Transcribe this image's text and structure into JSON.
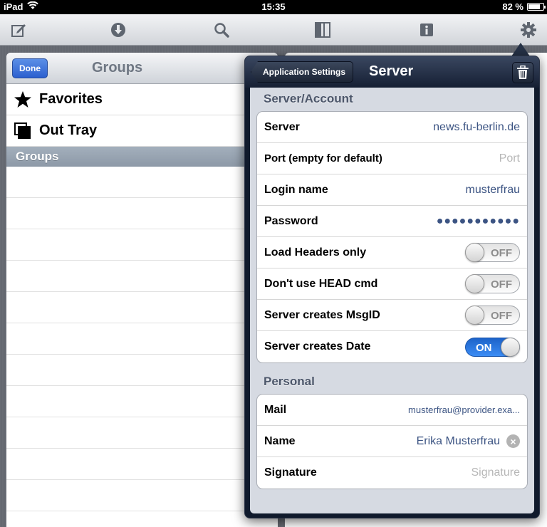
{
  "status_bar": {
    "device": "iPad",
    "time": "15:35",
    "battery": "82 %",
    "battery_level": 0.82
  },
  "toolbar": {
    "icons": [
      "compose-icon",
      "download-icon",
      "search-icon",
      "split-view-icon",
      "info-icon",
      "gear-icon"
    ]
  },
  "groups_panel": {
    "done_label": "Done",
    "title": "Groups",
    "items": [
      {
        "label": "Favorites",
        "icon": "star-icon"
      },
      {
        "label": "Out Tray",
        "icon": "out-tray-icon"
      }
    ],
    "section_header": "Groups"
  },
  "popover": {
    "back_label": "Application Settings",
    "title": "Server",
    "server_account_header": "Server/Account",
    "server_account_rows": {
      "server": {
        "label": "Server",
        "value": "news.fu-berlin.de"
      },
      "port": {
        "label": "Port (empty for default)",
        "placeholder": "Port"
      },
      "login": {
        "label": "Login name",
        "value": "musterfrau"
      },
      "password": {
        "label": "Password",
        "value": "●●●●●●●●●●●"
      },
      "load_headers": {
        "label": "Load Headers only",
        "state": "OFF"
      },
      "no_head": {
        "label": "Don't use HEAD cmd",
        "state": "OFF"
      },
      "msgid": {
        "label": "Server creates MsgID",
        "state": "OFF"
      },
      "date": {
        "label": "Server creates Date",
        "state": "ON"
      }
    },
    "personal_header": "Personal",
    "personal_rows": {
      "mail": {
        "label": "Mail",
        "value": "musterfrau@provider.exa..."
      },
      "name": {
        "label": "Name",
        "value": "Erika Musterfrau"
      },
      "signature": {
        "label": "Signature",
        "placeholder": "Signature"
      }
    }
  }
}
